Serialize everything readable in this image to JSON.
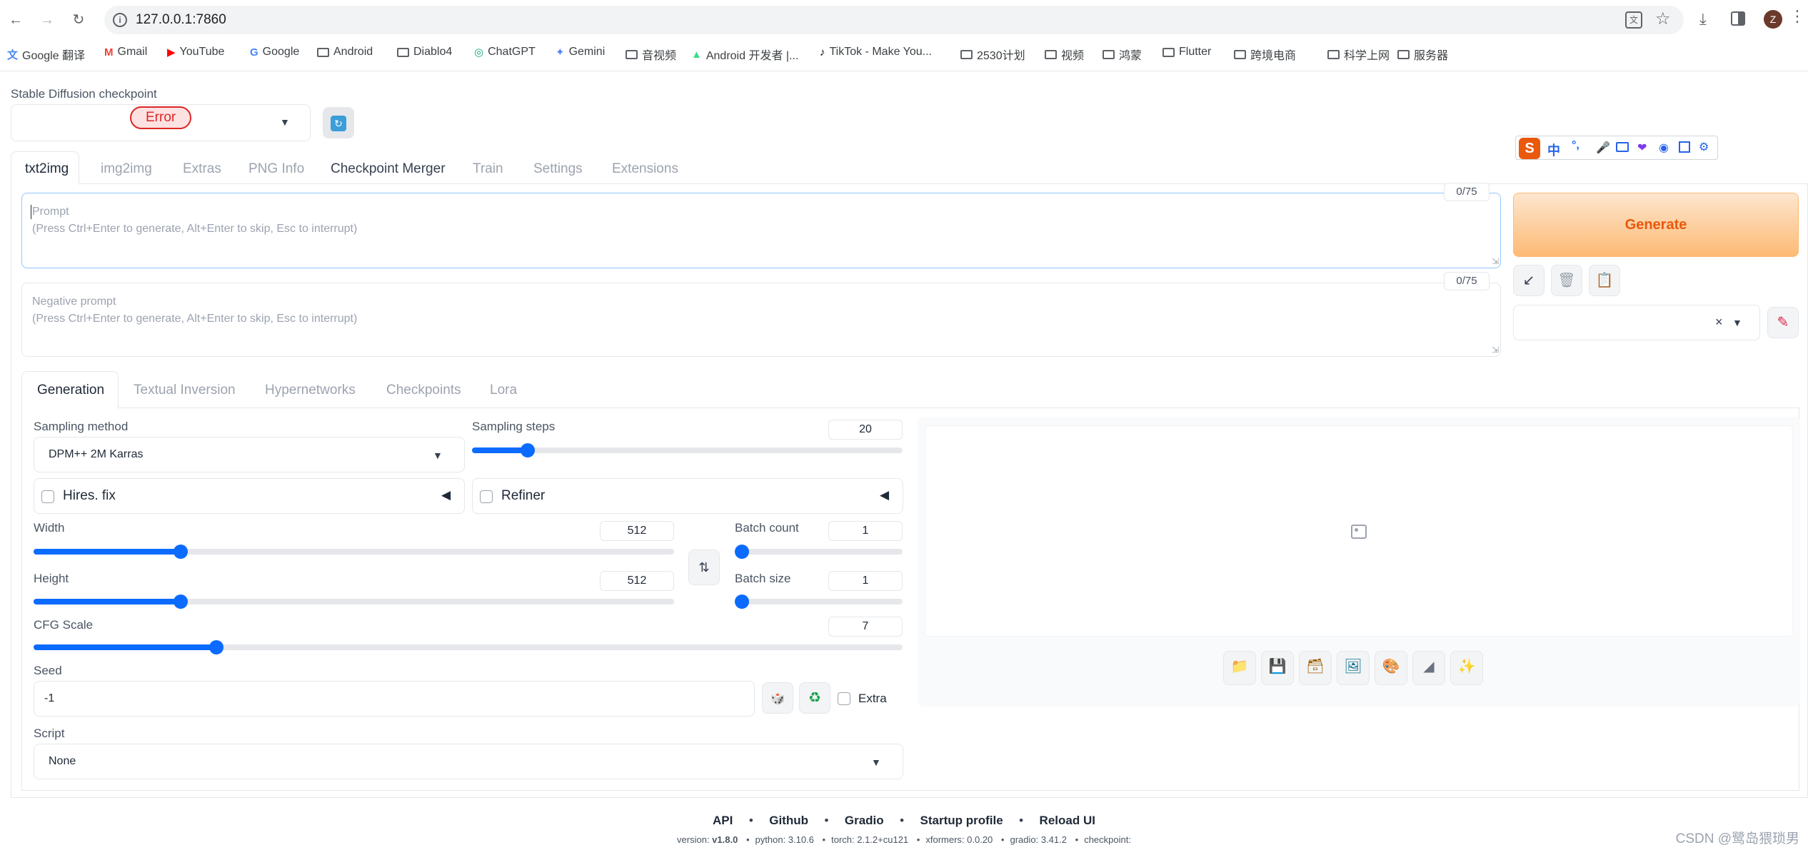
{
  "browser": {
    "url": "127.0.0.1:7860",
    "avatar_letter": "Z",
    "bookmarks": [
      "Google 翻译",
      "Gmail",
      "YouTube",
      "Google",
      "Android",
      "Diablo4",
      "ChatGPT",
      "Gemini",
      "音视频",
      "Android 开发者 |...",
      "TikTok - Make You...",
      "2530计划",
      "视频",
      "鸿蒙",
      "Flutter",
      "跨境电商",
      "科学上网",
      "服务器"
    ]
  },
  "checkpoint": {
    "label": "Stable Diffusion checkpoint",
    "error_badge": "Error"
  },
  "tabs": [
    "txt2img",
    "img2img",
    "Extras",
    "PNG Info",
    "Checkpoint Merger",
    "Train",
    "Settings",
    "Extensions"
  ],
  "prompt": {
    "placeholder": "Prompt\n(Press Ctrl+Enter to generate, Alt+Enter to skip, Esc to interrupt)",
    "token_count": "0/75"
  },
  "negative_prompt": {
    "placeholder": "Negative prompt\n(Press Ctrl+Enter to generate, Alt+Enter to skip, Esc to interrupt)",
    "token_count": "0/75"
  },
  "generate_label": "Generate",
  "subtabs": [
    "Generation",
    "Textual Inversion",
    "Hypernetworks",
    "Checkpoints",
    "Lora"
  ],
  "generation": {
    "sampling_method_label": "Sampling method",
    "sampling_method_value": "DPM++ 2M Karras",
    "sampling_steps_label": "Sampling steps",
    "sampling_steps_value": "20",
    "sampling_steps_fraction": 0.13,
    "hires_label": "Hires. fix",
    "refiner_label": "Refiner",
    "width_label": "Width",
    "width_value": "512",
    "width_fraction": 0.23,
    "height_label": "Height",
    "height_value": "512",
    "height_fraction": 0.23,
    "batch_count_label": "Batch count",
    "batch_count_value": "1",
    "batch_count_fraction": 0.0,
    "batch_size_label": "Batch size",
    "batch_size_value": "1",
    "batch_size_fraction": 0.0,
    "cfg_label": "CFG Scale",
    "cfg_value": "7",
    "cfg_fraction": 0.21,
    "seed_label": "Seed",
    "seed_value": "-1",
    "extra_label": "Extra",
    "script_label": "Script",
    "script_value": "None"
  },
  "footer": {
    "links": [
      "API",
      "Github",
      "Gradio",
      "Startup profile",
      "Reload UI"
    ],
    "version_line": {
      "version_prefix": "version: ",
      "version": "v1.8.0",
      "python": "python: 3.10.6",
      "torch": "torch: 2.1.2+cu121",
      "xformers": "xformers: 0.0.20",
      "gradio": "gradio: 3.41.2",
      "checkpoint": "checkpoint:"
    }
  },
  "watermark": "CSDN @鹭岛猥琐男",
  "ime_toolbar": [
    "中",
    "°,"
  ],
  "colors": {
    "accent": "#0b6bff",
    "generate_text": "#ea580c",
    "error": "#dc2626"
  }
}
